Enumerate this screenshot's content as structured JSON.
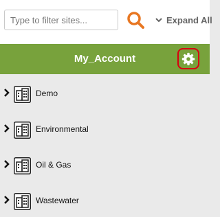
{
  "filter": {
    "placeholder": "Type to filter sites..."
  },
  "search": {
    "icon": "search-icon",
    "color": "#e87722"
  },
  "expand_all": {
    "label": "Expand All"
  },
  "account": {
    "title": "My_Account",
    "bar_color": "#78a23c"
  },
  "settings": {
    "icon": "gear-icon",
    "highlight_color": "#d8000f"
  },
  "sites": [
    {
      "label": "Demo"
    },
    {
      "label": "Environmental"
    },
    {
      "label": "Oil & Gas"
    },
    {
      "label": "Wastewater"
    }
  ]
}
